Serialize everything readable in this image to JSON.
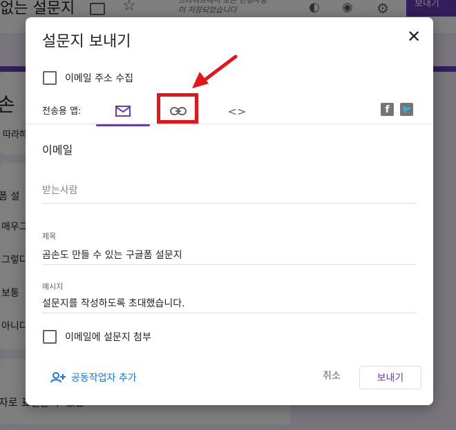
{
  "background": {
    "doc_title": "없는 설문지",
    "save_status": "드라이브에서 모든 변경사항\n이 저장되었습니다",
    "send_button": "보내기",
    "form_title": "손",
    "form_desc": "따라하",
    "question_title": "폼 설",
    "options": [
      "매우그",
      "그렇다",
      "보통",
      "아니다"
    ],
    "bottom_text": "자로 표현할 수 있는"
  },
  "dialog": {
    "title": "설문지 보내기",
    "collect_email_label": "이메일 주소 수집",
    "send_via_label": "전송용 앱:",
    "tabs": [
      {
        "name": "email",
        "icon": "mail-icon",
        "active": true
      },
      {
        "name": "link",
        "icon": "link-icon",
        "active": false
      },
      {
        "name": "embed",
        "icon": "code-icon",
        "glyph": "<>",
        "active": false
      }
    ],
    "social": [
      {
        "name": "facebook",
        "icon": "facebook-icon",
        "glyph": "f"
      },
      {
        "name": "twitter",
        "icon": "twitter-icon",
        "glyph": "🐦"
      }
    ],
    "section_title": "이메일",
    "to_placeholder": "받는사람",
    "subject_label": "제목",
    "subject_value": "곰손도 만들 수 있는 구글폼 설문지",
    "message_label": "메시지",
    "message_value": "설문지를 작성하도록 초대했습니다.",
    "attach_label": "이메일에 설문지 첨부",
    "add_collaborators": "공동작업자 추가",
    "cancel": "취소",
    "send": "보내기"
  },
  "colors": {
    "accent": "#673ab7",
    "link": "#1a73e8",
    "highlight": "#e5141b"
  }
}
